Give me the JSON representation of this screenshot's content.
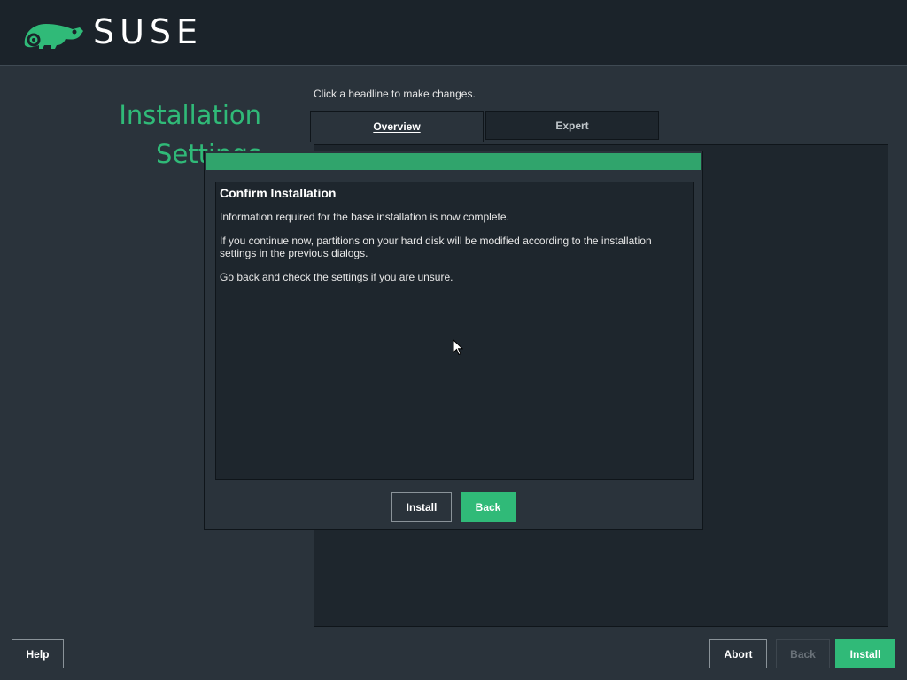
{
  "brand": {
    "name": "SUSE",
    "color": "#30ba78",
    "logo_icon": "chameleon-logo"
  },
  "page": {
    "title": "Installation Settings",
    "hint": "Click a headline to make changes."
  },
  "tabs": [
    {
      "label": "Overview",
      "selected": true
    },
    {
      "label": "Expert",
      "selected": false
    }
  ],
  "dialog": {
    "heading": "Confirm Installation",
    "paragraphs": [
      "Information required for the base installation is now complete.",
      "If you continue now, partitions on your hard disk will be modified according to the installation settings in the previous dialogs.",
      "Go back and check the settings if you are unsure."
    ],
    "install_label": "Install",
    "back_label": "Back"
  },
  "footer": {
    "help_label": "Help",
    "abort_label": "Abort",
    "back_label": "Back",
    "back_enabled": false,
    "install_label": "Install"
  }
}
